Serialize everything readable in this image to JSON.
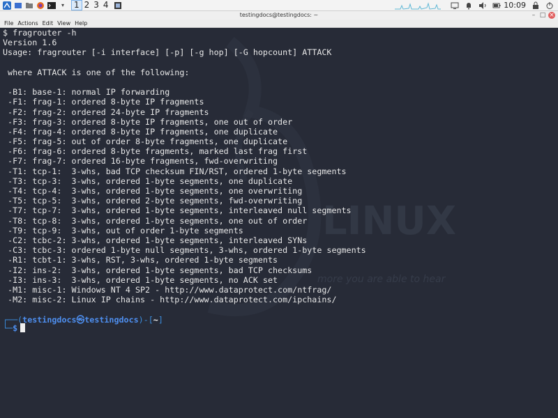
{
  "taskbar": {
    "workspaces": [
      "1",
      "2",
      "3",
      "4"
    ],
    "active_workspace": "1",
    "clock": "10:09"
  },
  "window": {
    "title": "testingdocs@testingdocs: ~"
  },
  "menu": [
    "File",
    "Actions",
    "Edit",
    "View",
    "Help"
  ],
  "terminal": {
    "lines": [
      "$ fragrouter -h",
      "Version 1.6",
      "Usage: fragrouter [-i interface] [-p] [-g hop] [-G hopcount] ATTACK",
      "",
      " where ATTACK is one of the following:",
      "",
      " -B1: base-1: normal IP forwarding",
      " -F1: frag-1: ordered 8-byte IP fragments",
      " -F2: frag-2: ordered 24-byte IP fragments",
      " -F3: frag-3: ordered 8-byte IP fragments, one out of order",
      " -F4: frag-4: ordered 8-byte IP fragments, one duplicate",
      " -F5: frag-5: out of order 8-byte fragments, one duplicate",
      " -F6: frag-6: ordered 8-byte fragments, marked last frag first",
      " -F7: frag-7: ordered 16-byte fragments, fwd-overwriting",
      " -T1: tcp-1:  3-whs, bad TCP checksum FIN/RST, ordered 1-byte segments",
      " -T3: tcp-3:  3-whs, ordered 1-byte segments, one duplicate",
      " -T4: tcp-4:  3-whs, ordered 1-byte segments, one overwriting",
      " -T5: tcp-5:  3-whs, ordered 2-byte segments, fwd-overwriting",
      " -T7: tcp-7:  3-whs, ordered 1-byte segments, interleaved null segments",
      " -T8: tcp-8:  3-whs, ordered 1-byte segments, one out of order",
      " -T9: tcp-9:  3-whs, out of order 1-byte segments",
      " -C2: tcbc-2: 3-whs, ordered 1-byte segments, interleaved SYNs",
      " -C3: tcbc-3: ordered 1-byte null segments, 3-whs, ordered 1-byte segments",
      " -R1: tcbt-1: 3-whs, RST, 3-whs, ordered 1-byte segments",
      " -I2: ins-2:  3-whs, ordered 1-byte segments, bad TCP checksums",
      " -I3: ins-3:  3-whs, ordered 1-byte segments, no ACK set",
      " -M1: misc-1: Windows NT 4 SP2 - http://www.dataprotect.com/ntfrag/",
      " -M2: misc-2: Linux IP chains - http://www.dataprotect.com/ipchains/"
    ],
    "prompt": {
      "user_host": "testingdocs㉿testingdocs",
      "path": "~",
      "symbol": "$"
    }
  },
  "watermark": {
    "logo_text": "LINUX",
    "tagline": "more you are able to hear"
  }
}
